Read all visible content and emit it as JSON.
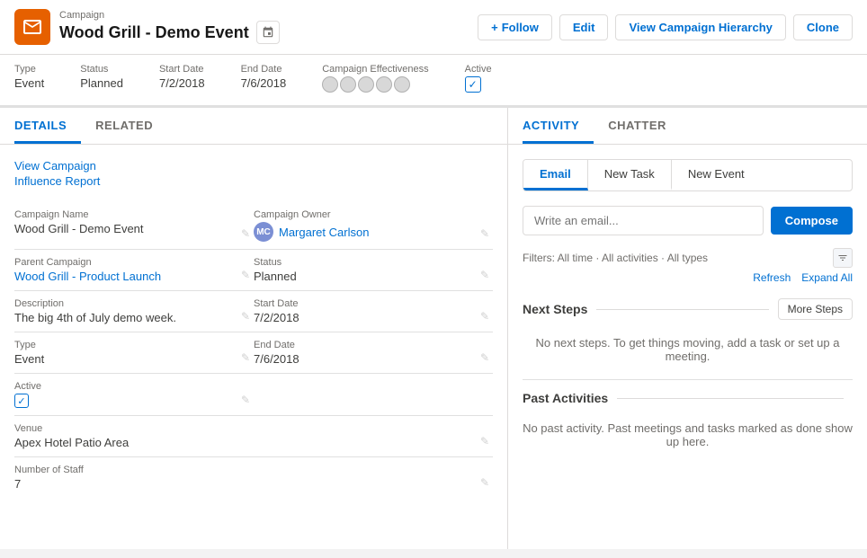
{
  "header": {
    "breadcrumb": "Campaign",
    "title": "Wood Grill - Demo Event",
    "follow_label": "Follow",
    "edit_label": "Edit",
    "view_hierarchy_label": "View Campaign Hierarchy",
    "clone_label": "Clone"
  },
  "meta": {
    "type_label": "Type",
    "type_value": "Event",
    "status_label": "Status",
    "status_value": "Planned",
    "start_date_label": "Start Date",
    "start_date_value": "7/2/2018",
    "end_date_label": "End Date",
    "end_date_value": "7/6/2018",
    "effectiveness_label": "Campaign Effectiveness",
    "active_label": "Active"
  },
  "tabs_left": {
    "details_label": "DETAILS",
    "related_label": "RELATED"
  },
  "details": {
    "view_campaign_label": "View Campaign",
    "influence_report_label": "Influence Report",
    "campaign_name_label": "Campaign Name",
    "campaign_name_value": "Wood Grill - Demo Event",
    "campaign_owner_label": "Campaign Owner",
    "campaign_owner_value": "Margaret Carlson",
    "parent_campaign_label": "Parent Campaign",
    "parent_campaign_value": "Wood Grill - Product Launch",
    "status_label": "Status",
    "status_value": "Planned",
    "description_label": "Description",
    "description_value": "The big 4th of July demo week.",
    "start_date_label": "Start Date",
    "start_date_value": "7/2/2018",
    "type_label": "Type",
    "type_value": "Event",
    "end_date_label": "End Date",
    "end_date_value": "7/6/2018",
    "active_label": "Active",
    "venue_label": "Venue",
    "venue_value": "Apex Hotel Patio Area",
    "num_staff_label": "Number of Staff",
    "num_staff_value": "7"
  },
  "activity": {
    "activity_tab_label": "ACTIVITY",
    "chatter_tab_label": "CHATTER",
    "email_tab_label": "Email",
    "new_task_label": "New Task",
    "new_event_label": "New Event",
    "email_placeholder": "Write an email...",
    "compose_label": "Compose",
    "filters_text": "Filters: All time · All activities · All types",
    "refresh_label": "Refresh",
    "expand_all_label": "Expand All",
    "next_steps_label": "Next Steps",
    "more_steps_label": "More Steps",
    "next_steps_empty": "No next steps. To get things moving, add a task or set up a meeting.",
    "past_activities_label": "Past Activities",
    "past_activities_empty": "No past activity. Past meetings and tasks marked as done show up here."
  }
}
